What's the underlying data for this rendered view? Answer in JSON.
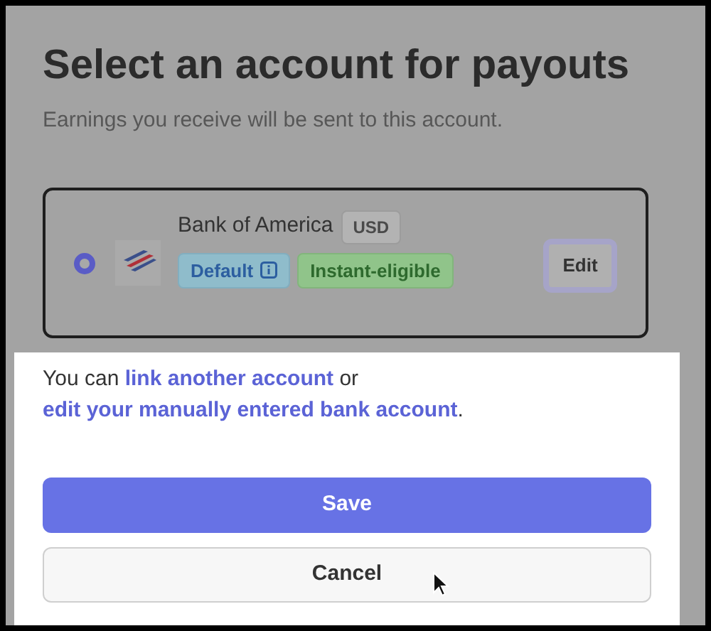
{
  "title": "Select an account for payouts",
  "subtitle": "Earnings you receive will be sent to this account.",
  "accounts": [
    {
      "name": "Bank of America",
      "currency": "USD",
      "selected": true,
      "badges": [
        {
          "label": "Default",
          "kind": "default"
        },
        {
          "label": "Instant-eligible",
          "kind": "instant"
        }
      ],
      "edit_label": "Edit"
    }
  ],
  "note": [
    {
      "kind": "text",
      "text": "You can "
    },
    {
      "kind": "link",
      "text": "link another account"
    },
    {
      "kind": "text",
      "text": " or "
    },
    {
      "kind": "link",
      "text": "edit your manually entered bank account"
    },
    {
      "kind": "text",
      "text": "."
    }
  ],
  "buttons": [
    {
      "label": "Save",
      "kind": "primary"
    },
    {
      "label": "Cancel",
      "kind": "secondary"
    }
  ]
}
